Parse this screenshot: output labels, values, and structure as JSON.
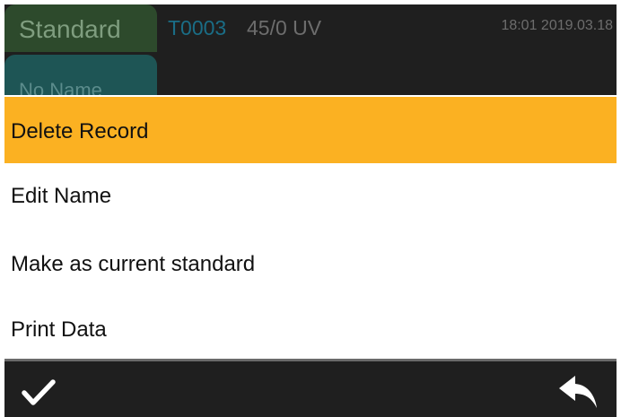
{
  "header": {
    "tabs": [
      {
        "label": "Standard"
      },
      {
        "label": "No Name"
      }
    ],
    "record_id": "T0003",
    "geometry": "45/0 UV",
    "datetime": "18:01 2019.03.18"
  },
  "menu": {
    "items": [
      {
        "label": "Delete Record",
        "selected": true
      },
      {
        "label": "Edit Name",
        "selected": false
      },
      {
        "label": "Make as current standard",
        "selected": false
      },
      {
        "label": "Print Data",
        "selected": false
      }
    ]
  },
  "footer": {
    "confirm_icon": "check-icon",
    "back_icon": "return-arrow-icon"
  },
  "colors": {
    "accent": "#fbb122",
    "dark_bg": "#1f1f1f",
    "standard_tab": "#2d4a2c",
    "name_tab": "#1e5555"
  }
}
